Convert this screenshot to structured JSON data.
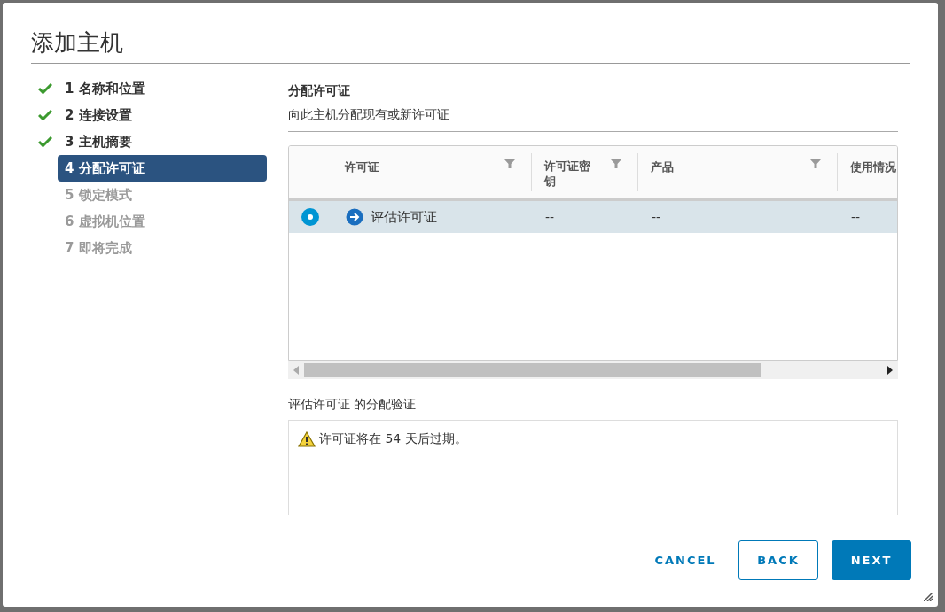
{
  "dialog": {
    "title": "添加主机"
  },
  "steps": [
    {
      "label": "1 名称和位置",
      "completed": true,
      "selected": false
    },
    {
      "label": "2 连接设置",
      "completed": true,
      "selected": false
    },
    {
      "label": "3 主机摘要",
      "completed": true,
      "selected": false
    },
    {
      "label": "4 分配许可证",
      "completed": false,
      "selected": true
    },
    {
      "label": "5 锁定模式",
      "completed": false,
      "selected": false
    },
    {
      "label": "6 虚拟机位置",
      "completed": false,
      "selected": false
    },
    {
      "label": "7 即将完成",
      "completed": false,
      "selected": false
    }
  ],
  "section": {
    "title": "分配许可证",
    "subtitle": "向此主机分配现有或新许可证"
  },
  "table": {
    "columns": [
      {
        "label": "许可证",
        "filter": true
      },
      {
        "label": "许可证密钥",
        "filter": true
      },
      {
        "label": "产品",
        "filter": true
      },
      {
        "label": "使用情况"
      }
    ],
    "rows": [
      {
        "selected": true,
        "cells": [
          "评估许可证",
          "--",
          "--",
          "--"
        ]
      }
    ]
  },
  "validation": {
    "label": "评估许可证 的分配验证",
    "messages": [
      "许可证将在 54 天后过期。"
    ]
  },
  "buttons": [
    {
      "label": "CANCEL",
      "kind": "link"
    },
    {
      "label": "BACK",
      "kind": "outline"
    },
    {
      "label": "NEXT",
      "kind": "primary"
    }
  ]
}
